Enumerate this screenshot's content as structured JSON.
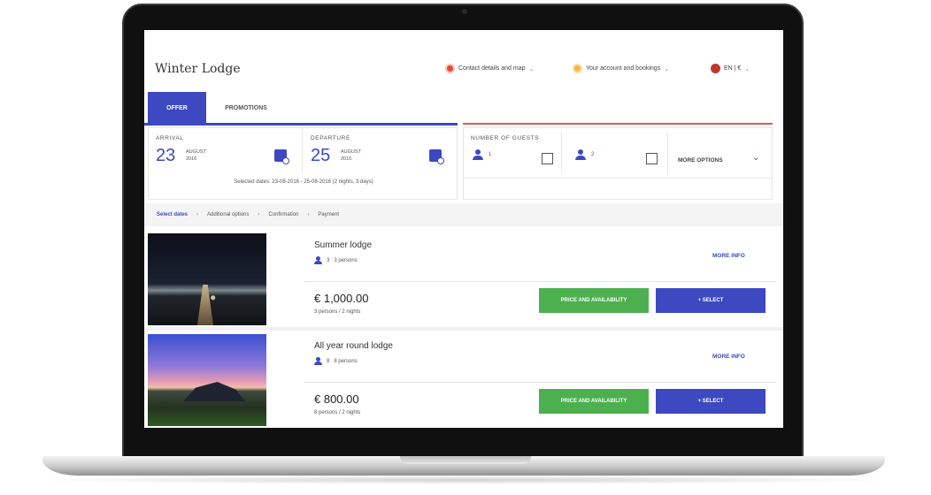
{
  "header": {
    "title": "Winter Lodge",
    "contact": "Contact details and map",
    "account": "Your account and bookings",
    "lang": "EN  |  €"
  },
  "tabs": [
    {
      "label": "OFFER"
    },
    {
      "label": "PROMOTIONS"
    }
  ],
  "dates": {
    "arrival": {
      "label": "ARRIVAL",
      "day": "23",
      "month": "AUGUST",
      "year": "2016"
    },
    "departure": {
      "label": "DEPARTURE",
      "day": "25",
      "month": "AUGUST",
      "year": "2016"
    },
    "selected": "Selected dates: 23-08-2016 - 25-08-2016 (2 nights, 3 days)"
  },
  "guests": {
    "label": "NUMBER OF GUESTS",
    "adults": "1",
    "children": "2",
    "more_options": "MORE OPTIONS"
  },
  "breadcrumb": [
    "Select dates",
    "Additional options",
    "Confirmation",
    "Payment"
  ],
  "results": [
    {
      "name": "Summer lodge",
      "persons_count": "3",
      "persons_text": "3 persons",
      "more_info": "MORE INFO",
      "price": "€ 1,000.00",
      "sub": "3 persons / 2 nights",
      "btn_price": "PRICE AND AVAILABILITY",
      "btn_select": "+ SELECT"
    },
    {
      "name": "All year round lodge",
      "persons_count": "8",
      "persons_text": "8 persons",
      "more_info": "MORE INFO",
      "price": "€ 800.00",
      "sub": "8 persons / 2 nights",
      "btn_price": "PRICE AND AVAILABILITY",
      "btn_select": "+ SELECT"
    }
  ],
  "colors": {
    "accent": "#3c49c1",
    "green": "#4db04f",
    "red_line": "#e05a4e"
  },
  "icons": [
    "pin-icon",
    "user-icon",
    "globe-icon",
    "calendar-icon",
    "person-icon",
    "chevron-down-icon"
  ]
}
